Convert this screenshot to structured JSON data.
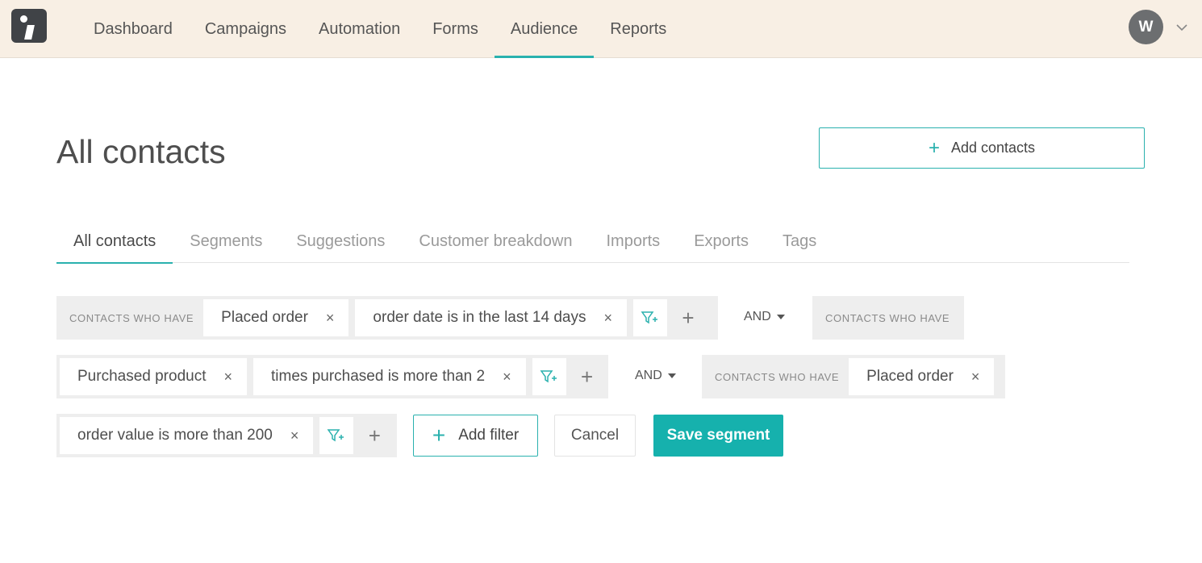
{
  "nav": {
    "items": [
      {
        "label": "Dashboard",
        "active": false
      },
      {
        "label": "Campaigns",
        "active": false
      },
      {
        "label": "Automation",
        "active": false
      },
      {
        "label": "Forms",
        "active": false
      },
      {
        "label": "Audience",
        "active": true
      },
      {
        "label": "Reports",
        "active": false
      }
    ],
    "avatar_initial": "W"
  },
  "header": {
    "title": "All contacts",
    "add_contacts_label": "Add contacts"
  },
  "tabs": [
    {
      "label": "All contacts",
      "active": true
    },
    {
      "label": "Segments",
      "active": false
    },
    {
      "label": "Suggestions",
      "active": false
    },
    {
      "label": "Customer breakdown",
      "active": false
    },
    {
      "label": "Imports",
      "active": false
    },
    {
      "label": "Exports",
      "active": false
    },
    {
      "label": "Tags",
      "active": false
    }
  ],
  "filters": {
    "group_label": "CONTACTS WHO HAVE",
    "operator": "AND",
    "groups": [
      {
        "event": "Placed order",
        "condition": "order date is in the last 14 days"
      },
      {
        "event": "Purchased product",
        "condition": "times purchased is more than 2"
      },
      {
        "event": "Placed order",
        "condition": "order value is more than 200"
      }
    ],
    "remove_glyph": "×",
    "add_glyph": "+"
  },
  "actions": {
    "add_filter_label": "Add filter",
    "cancel_label": "Cancel",
    "save_label": "Save segment"
  },
  "colors": {
    "accent": "#2ab1ae",
    "topbar_bg": "#f8efe4",
    "save_bg": "#16b1ad"
  }
}
